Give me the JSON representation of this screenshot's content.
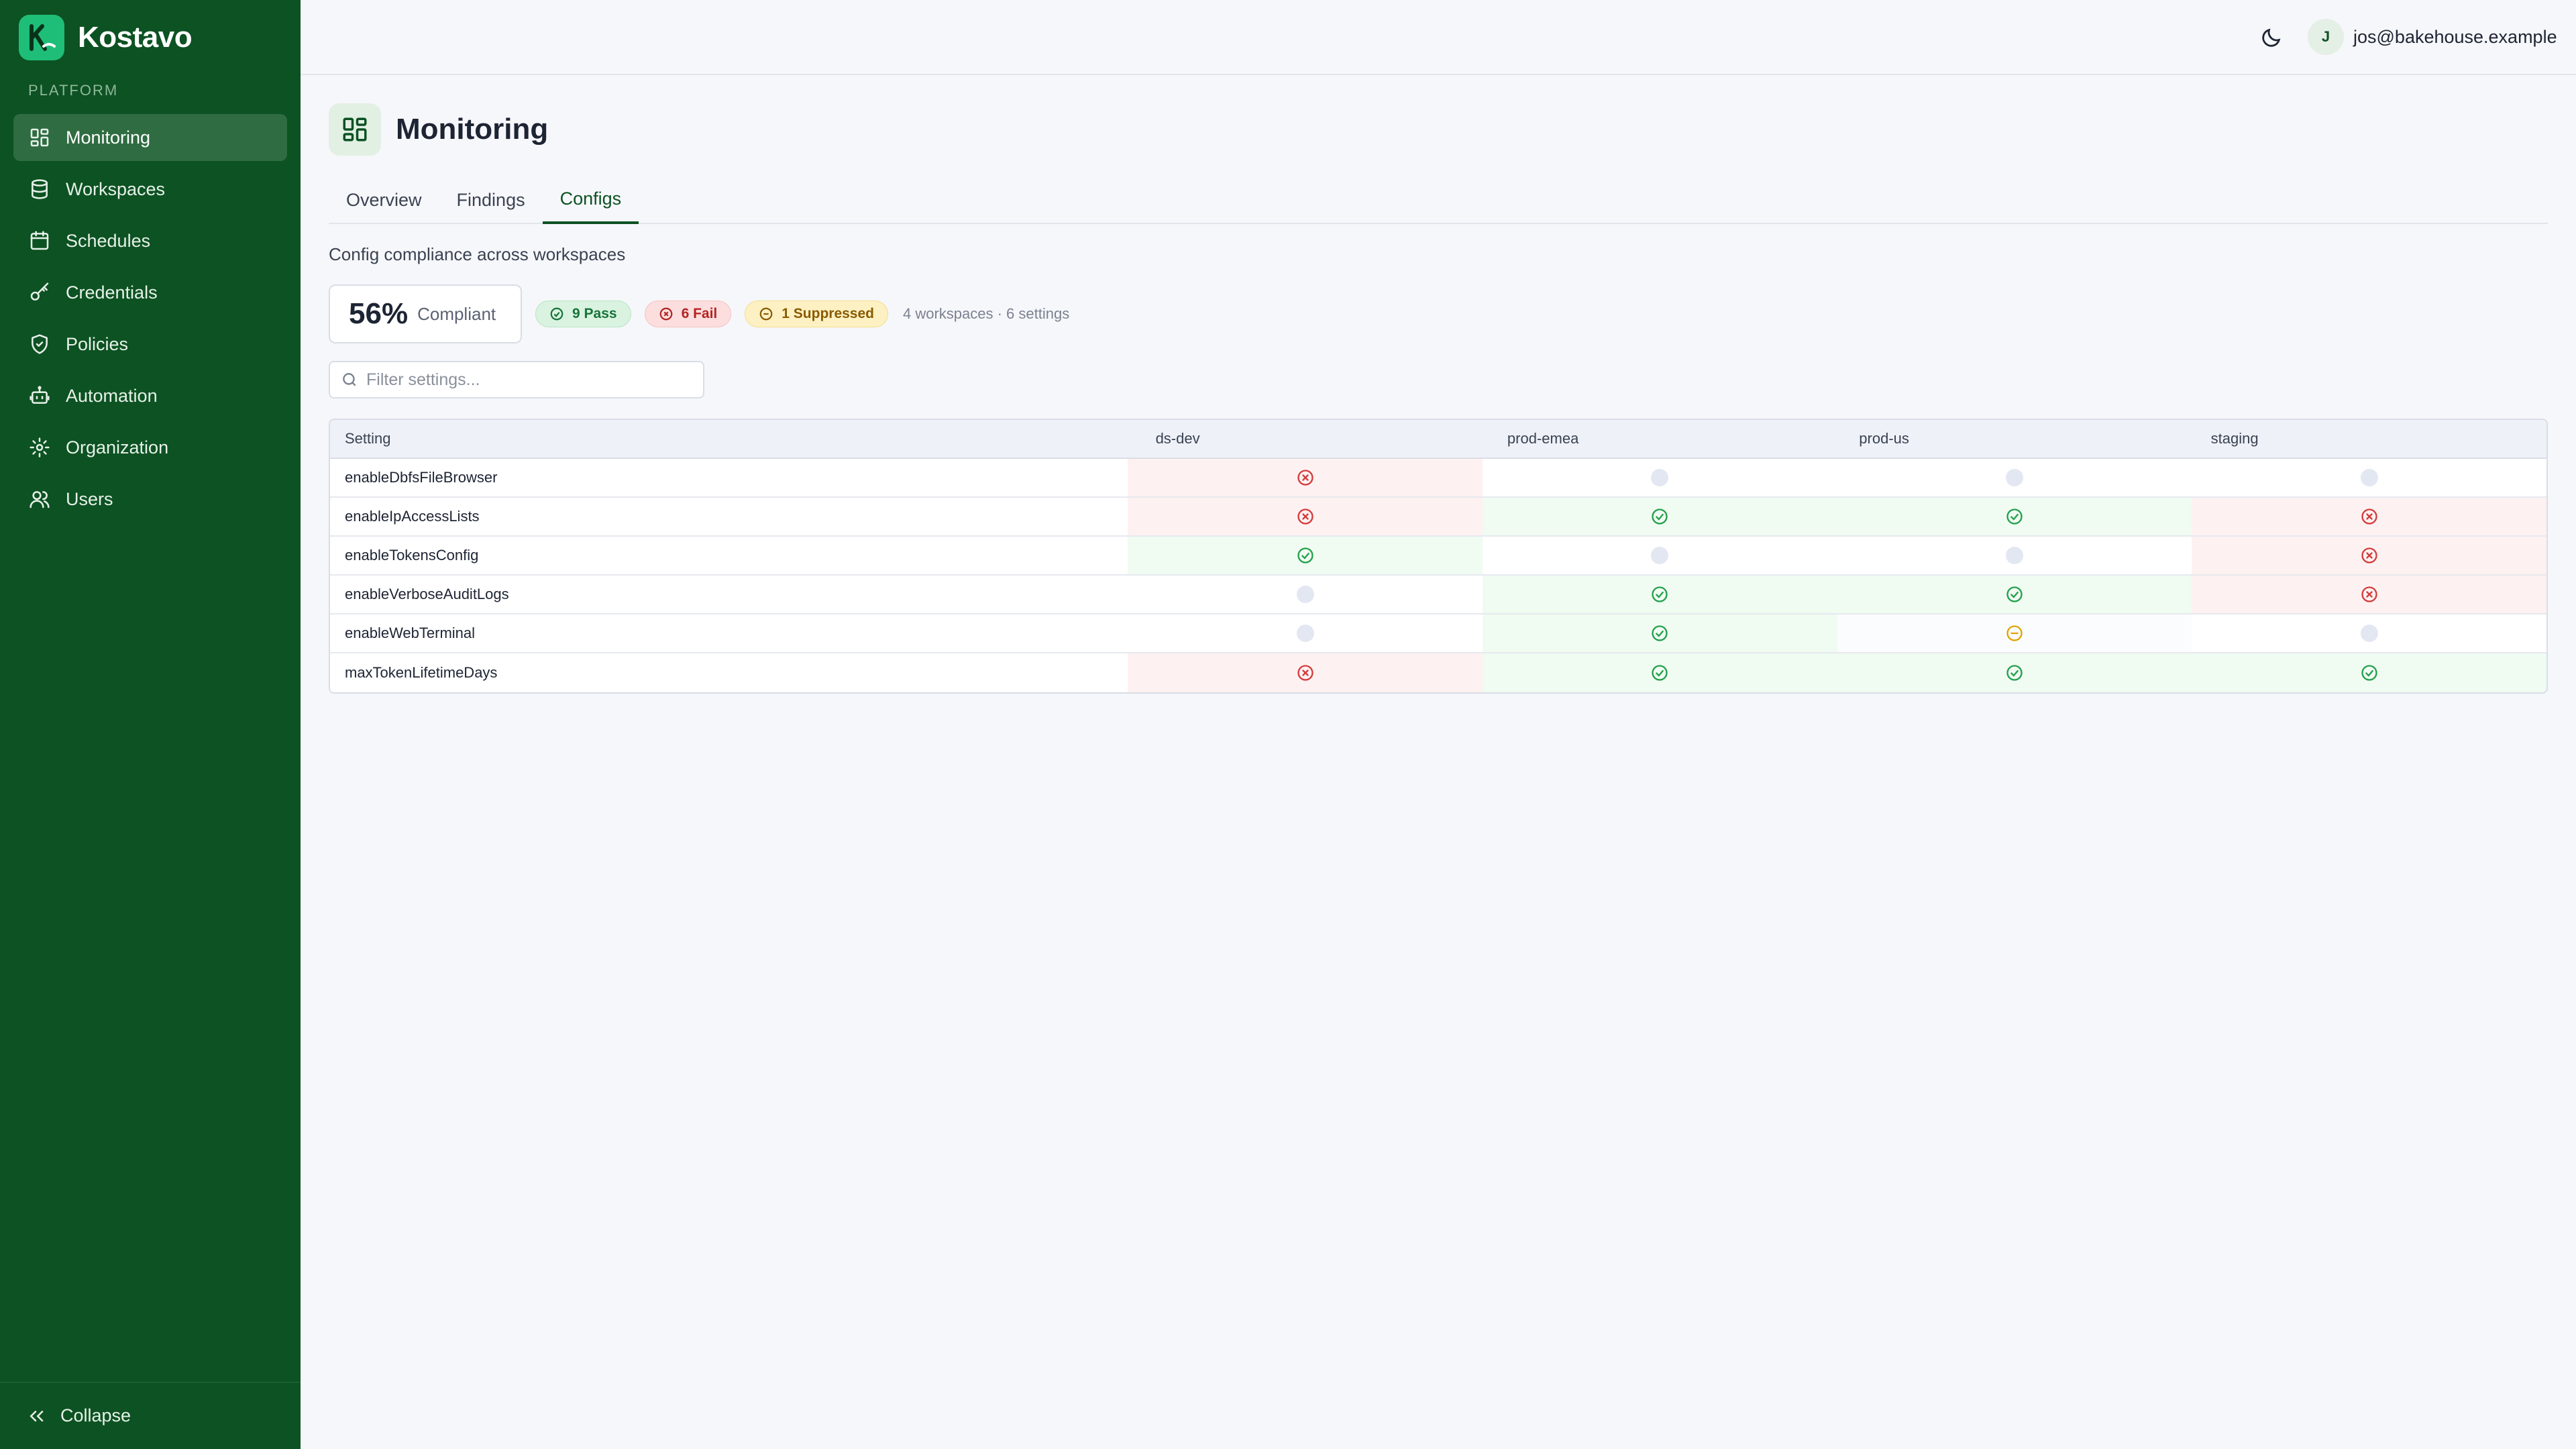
{
  "app": {
    "name": "Kostavo"
  },
  "sidebar": {
    "section_label": "PLATFORM",
    "items": [
      {
        "label": "Monitoring",
        "icon": "dashboard-icon",
        "active": true
      },
      {
        "label": "Workspaces",
        "icon": "database-icon",
        "active": false
      },
      {
        "label": "Schedules",
        "icon": "calendar-icon",
        "active": false
      },
      {
        "label": "Credentials",
        "icon": "key-icon",
        "active": false
      },
      {
        "label": "Policies",
        "icon": "shield-icon",
        "active": false
      },
      {
        "label": "Automation",
        "icon": "robot-icon",
        "active": false
      },
      {
        "label": "Organization",
        "icon": "gear-icon",
        "active": false
      },
      {
        "label": "Users",
        "icon": "users-icon",
        "active": false
      }
    ],
    "collapse_label": "Collapse"
  },
  "topbar": {
    "user_initial": "J",
    "user_email": "jos@bakehouse.example"
  },
  "page": {
    "title": "Monitoring",
    "tabs": [
      {
        "label": "Overview",
        "active": false
      },
      {
        "label": "Findings",
        "active": false
      },
      {
        "label": "Configs",
        "active": true
      }
    ],
    "subtitle": "Config compliance across workspaces",
    "stats": {
      "compliance_value": "56%",
      "compliance_label": "Compliant",
      "pass_label": "9 Pass",
      "fail_label": "6 Fail",
      "suppressed_label": "1 Suppressed",
      "meta": "4 workspaces · 6 settings"
    },
    "filter": {
      "placeholder": "Filter settings..."
    }
  },
  "grid": {
    "setting_header": "Setting",
    "workspaces": [
      "ds-dev",
      "prod-emea",
      "prod-us",
      "staging"
    ],
    "rows": [
      {
        "setting": "enableDbfsFileBrowser",
        "statuses": [
          "fail",
          "na",
          "na",
          "na"
        ]
      },
      {
        "setting": "enableIpAccessLists",
        "statuses": [
          "fail",
          "pass",
          "pass",
          "fail"
        ]
      },
      {
        "setting": "enableTokensConfig",
        "statuses": [
          "pass",
          "na",
          "na",
          "fail"
        ]
      },
      {
        "setting": "enableVerboseAuditLogs",
        "statuses": [
          "na",
          "pass",
          "pass",
          "fail"
        ]
      },
      {
        "setting": "enableWebTerminal",
        "statuses": [
          "na",
          "pass",
          "suppressed",
          "na"
        ]
      },
      {
        "setting": "maxTokenLifetimeDays",
        "statuses": [
          "fail",
          "pass",
          "pass",
          "pass"
        ]
      }
    ]
  },
  "colors": {
    "sidebar_bg": "#0d5222",
    "accent": "#0d5222",
    "pass": "#22a04b",
    "fail": "#d33b3b",
    "suppressed": "#e0a400"
  }
}
